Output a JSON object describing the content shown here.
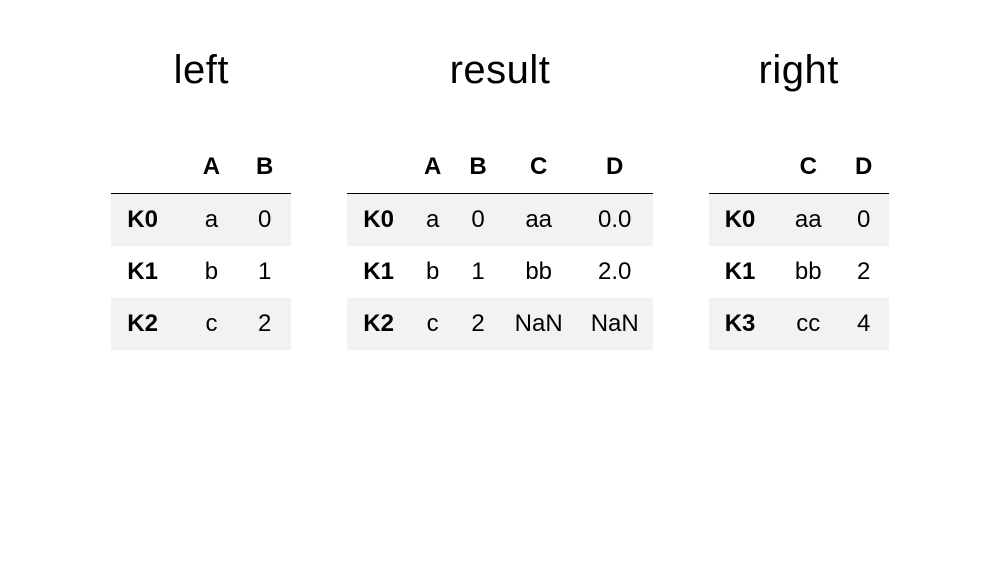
{
  "titles": {
    "left": "left",
    "result": "result",
    "right": "right"
  },
  "tables": {
    "left": {
      "columns": [
        "A",
        "B"
      ],
      "index": [
        "K0",
        "K1",
        "K2"
      ],
      "data": [
        [
          "a",
          "0"
        ],
        [
          "b",
          "1"
        ],
        [
          "c",
          "2"
        ]
      ]
    },
    "result": {
      "columns": [
        "A",
        "B",
        "C",
        "D"
      ],
      "index": [
        "K0",
        "K1",
        "K2"
      ],
      "data": [
        [
          "a",
          "0",
          "aa",
          "0.0"
        ],
        [
          "b",
          "1",
          "bb",
          "2.0"
        ],
        [
          "c",
          "2",
          "NaN",
          "NaN"
        ]
      ]
    },
    "right": {
      "columns": [
        "C",
        "D"
      ],
      "index": [
        "K0",
        "K1",
        "K3"
      ],
      "data": [
        [
          "aa",
          "0"
        ],
        [
          "bb",
          "2"
        ],
        [
          "cc",
          "4"
        ]
      ]
    }
  },
  "chart_data": [
    {
      "type": "table",
      "title": "left",
      "columns": [
        "A",
        "B"
      ],
      "index": [
        "K0",
        "K1",
        "K2"
      ],
      "rows": [
        {
          "A": "a",
          "B": 0
        },
        {
          "A": "b",
          "B": 1
        },
        {
          "A": "c",
          "B": 2
        }
      ]
    },
    {
      "type": "table",
      "title": "result",
      "columns": [
        "A",
        "B",
        "C",
        "D"
      ],
      "index": [
        "K0",
        "K1",
        "K2"
      ],
      "rows": [
        {
          "A": "a",
          "B": 0,
          "C": "aa",
          "D": 0.0
        },
        {
          "A": "b",
          "B": 1,
          "C": "bb",
          "D": 2.0
        },
        {
          "A": "c",
          "B": 2,
          "C": null,
          "D": null
        }
      ]
    },
    {
      "type": "table",
      "title": "right",
      "columns": [
        "C",
        "D"
      ],
      "index": [
        "K0",
        "K1",
        "K3"
      ],
      "rows": [
        {
          "C": "aa",
          "D": 0
        },
        {
          "C": "bb",
          "D": 2
        },
        {
          "C": "cc",
          "D": 4
        }
      ]
    }
  ]
}
